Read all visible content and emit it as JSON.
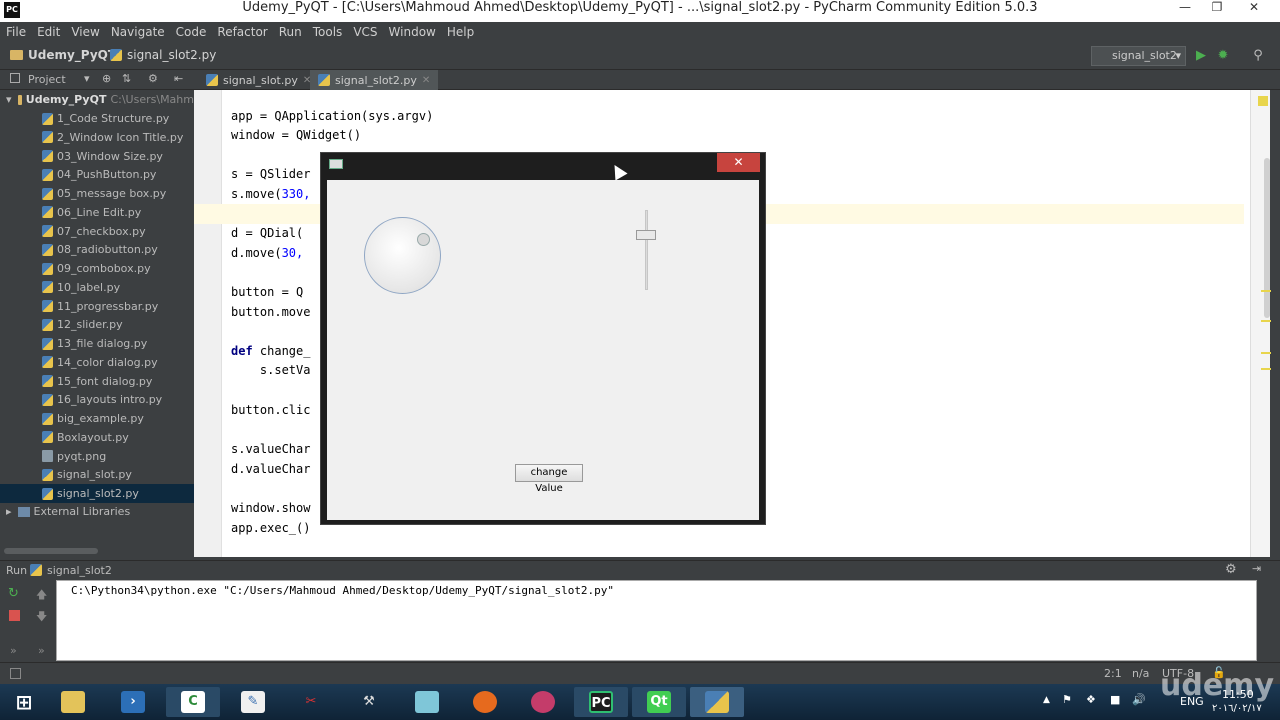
{
  "window": {
    "title": "Udemy_PyQT - [C:\\Users\\Mahmoud Ahmed\\Desktop\\Udemy_PyQT] - ...\\signal_slot2.py - PyCharm Community Edition 5.0.3",
    "app_icon": "PC"
  },
  "menu": [
    "File",
    "Edit",
    "View",
    "Navigate",
    "Code",
    "Refactor",
    "Run",
    "Tools",
    "VCS",
    "Window",
    "Help"
  ],
  "nav": {
    "project": "Udemy_PyQT",
    "file": "signal_slot2.py",
    "run_config": "signal_slot2"
  },
  "project_panel": {
    "label": "Project"
  },
  "tabs": [
    {
      "label": "signal_slot.py",
      "active": false
    },
    {
      "label": "signal_slot2.py",
      "active": true
    }
  ],
  "tree": {
    "root": "Udemy_PyQT",
    "root_path": "C:\\Users\\Mahm",
    "files": [
      "1_Code Structure.py",
      "2_Window Icon Title.py",
      "03_Window Size.py",
      "04_PushButton.py",
      "05_message box.py",
      "06_Line Edit.py",
      "07_checkbox.py",
      "08_radiobutton.py",
      "09_combobox.py",
      "10_label.py",
      "11_progressbar.py",
      "12_slider.py",
      "13_file dialog.py",
      "14_color dialog.py",
      "15_font dialog.py",
      "16_layouts intro.py",
      "big_example.py",
      "Boxlayout.py",
      "pyqt.png",
      "signal_slot.py",
      "signal_slot2.py"
    ],
    "selected": "signal_slot2.py",
    "external": "External Libraries"
  },
  "code": {
    "l1": "app = QApplication(sys.argv)",
    "l2": "window = QWidget()",
    "l3": "s = QSlider",
    "l4a": "s.move(",
    "l4b": "330,",
    "l5": "d = QDial(",
    "l6a": "d.move(",
    "l6b": "30,",
    "l7": "button = Q",
    "l8": "button.move",
    "l9kw": "def",
    "l9": " change_",
    "l10": "    s.setVa",
    "l11": "button.clic",
    "l12": "s.valueChar",
    "l13": "d.valueChar",
    "l14": "window.show",
    "l15": "app.exec_()"
  },
  "qt_window": {
    "button_label": "change Value",
    "close": "✕"
  },
  "run": {
    "label": "Run",
    "config": "signal_slot2",
    "console": "C:\\Python34\\python.exe \"C:/Users/Mahmoud Ahmed/Desktop/Udemy_PyQT/signal_slot2.py\""
  },
  "status": {
    "position": "2:1",
    "na": "n/a",
    "encoding": "UTF-8"
  },
  "tray": {
    "lang": "ENG",
    "time": "11:50",
    "date": "٢٠١٦/٠٢/١٧"
  },
  "watermark": "udemy"
}
